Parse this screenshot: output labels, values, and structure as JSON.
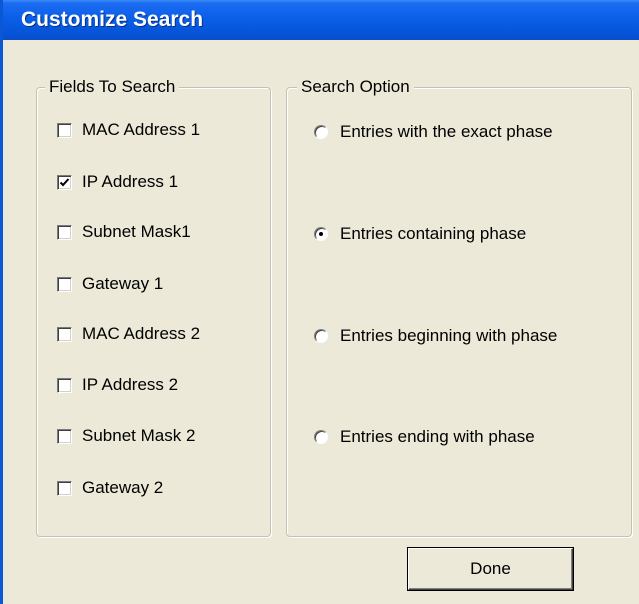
{
  "window": {
    "title": "Customize Search"
  },
  "fields_group": {
    "legend": "Fields To Search",
    "items": [
      {
        "label": "MAC Address 1",
        "checked": false
      },
      {
        "label": "IP Address 1",
        "checked": true
      },
      {
        "label": "Subnet Mask1",
        "checked": false
      },
      {
        "label": "Gateway 1",
        "checked": false
      },
      {
        "label": "MAC Address 2",
        "checked": false
      },
      {
        "label": "IP Address 2",
        "checked": false
      },
      {
        "label": "Subnet Mask 2",
        "checked": false
      },
      {
        "label": "Gateway 2",
        "checked": false
      }
    ]
  },
  "options_group": {
    "legend": "Search Option",
    "items": [
      {
        "label": "Entries with the exact phase",
        "selected": false
      },
      {
        "label": "Entries containing phase",
        "selected": true
      },
      {
        "label": "Entries beginning with phase",
        "selected": false
      },
      {
        "label": "Entries ending with phase",
        "selected": false
      }
    ]
  },
  "buttons": {
    "done_label": "Done"
  }
}
